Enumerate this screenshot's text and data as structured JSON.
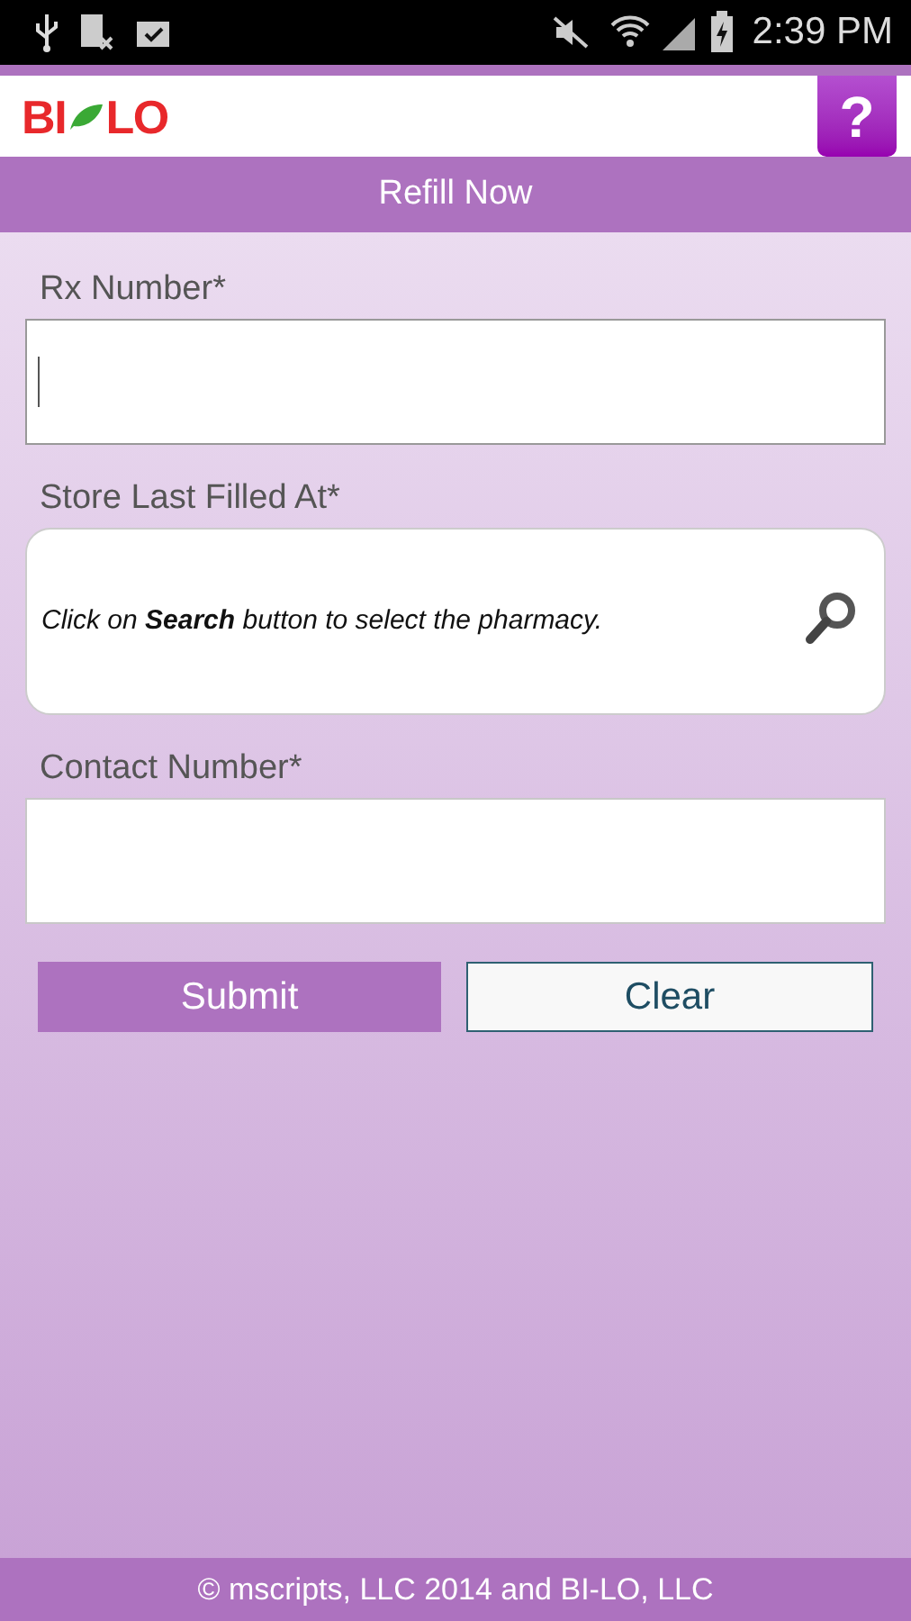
{
  "status_bar": {
    "time": "2:39 PM"
  },
  "header": {
    "logo": {
      "left": "BI",
      "right": "LO"
    },
    "help_label": "?"
  },
  "title": "Refill Now",
  "fields": [
    {
      "kind": "input",
      "label": "Rx Number*",
      "focused": true
    },
    {
      "kind": "picker",
      "label": "Store Last Filled At*",
      "hint": "Click on **Search** button to select the pharmacy."
    },
    {
      "kind": "input",
      "label": "Contact Number*",
      "focused": false
    }
  ],
  "buttons": [
    {
      "label": "Submit",
      "kind": "primary"
    },
    {
      "label": "Clear",
      "kind": "secondary"
    }
  ],
  "footer": "© mscripts, LLC 2014 and BI-LO, LLC"
}
